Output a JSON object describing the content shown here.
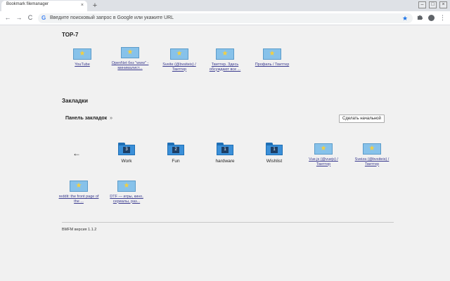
{
  "browser": {
    "tab_title": "Bookmark filemanager",
    "tab_close": "×",
    "new_tab": "+",
    "window_controls": [
      "–",
      "□",
      "×"
    ],
    "nav": {
      "back": "←",
      "forward": "→",
      "reload": "C"
    },
    "omnibox_icon": "G",
    "omnibox_placeholder": "Введите поисковый запрос в Google или укажите URL",
    "star": "★",
    "extensions_icon": "puzzle-icon",
    "menu": "⋮"
  },
  "top": {
    "title": "TOP-7",
    "items": [
      {
        "label": "YouTube"
      },
      {
        "label": "OpenNet без \"www\" - минималист..."
      },
      {
        "label": "Sveite (@bvsiteis) / Твиттер"
      },
      {
        "label": "Твиттер. Здесь обсуждают все ..."
      },
      {
        "label": "Профиль / Твиттер"
      }
    ]
  },
  "bookmarks": {
    "title": "Закладки",
    "breadcrumb": "Панель закладок",
    "breadcrumb_arrow": "»",
    "make_home_button": "Сделать начальной",
    "back_arrow": "←",
    "folders": [
      {
        "name": "Work",
        "count": "3"
      },
      {
        "name": "Fun",
        "count": "2"
      },
      {
        "name": "hardware",
        "count": "1"
      },
      {
        "name": "Wishlist",
        "count": "1"
      }
    ],
    "links": [
      {
        "label": "Vue.js (@vuejs) / Твиттер"
      },
      {
        "label": "Sveiza (@bvsiteis) / Твиттер"
      },
      {
        "label": "reddit: the front page of the ..."
      },
      {
        "label": "DTF — игры, кино, сериалы, раз..."
      }
    ]
  },
  "footer": {
    "version": "BMFM версия 1.1.2"
  },
  "colors": {
    "favicon_bg": "#87c2ea",
    "folder_blue": "#3a8fd8",
    "star_yellow": "#f4d03f",
    "link": "#3b3b8f"
  }
}
